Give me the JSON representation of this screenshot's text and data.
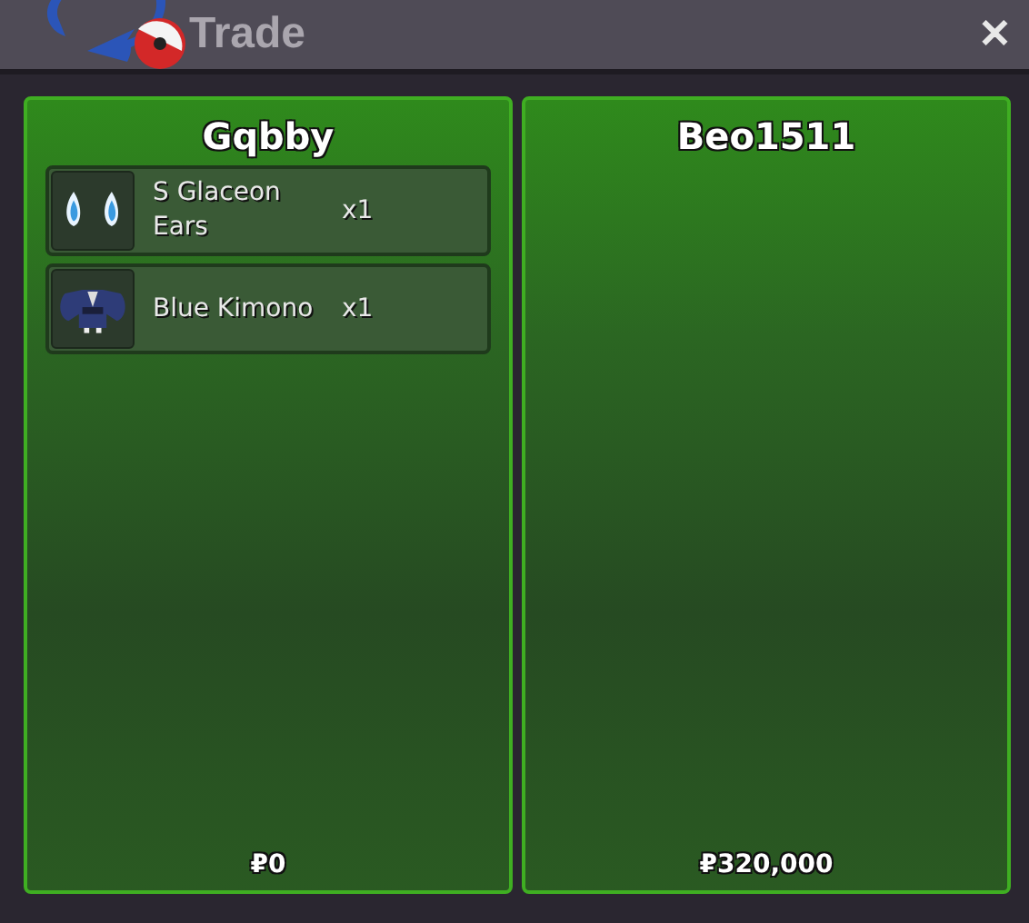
{
  "window": {
    "title": "Trade",
    "close": "✕"
  },
  "panels": [
    {
      "player": "Gqbby",
      "items": [
        {
          "kind": "ears",
          "name": "S Glaceon Ears",
          "qty": "x1"
        },
        {
          "kind": "kimono",
          "name": "Blue Kimono",
          "qty": "x1"
        }
      ],
      "currency": "₽",
      "money": "0"
    },
    {
      "player": "Beo1511",
      "currency": "₽",
      "money": "320,000"
    }
  ]
}
